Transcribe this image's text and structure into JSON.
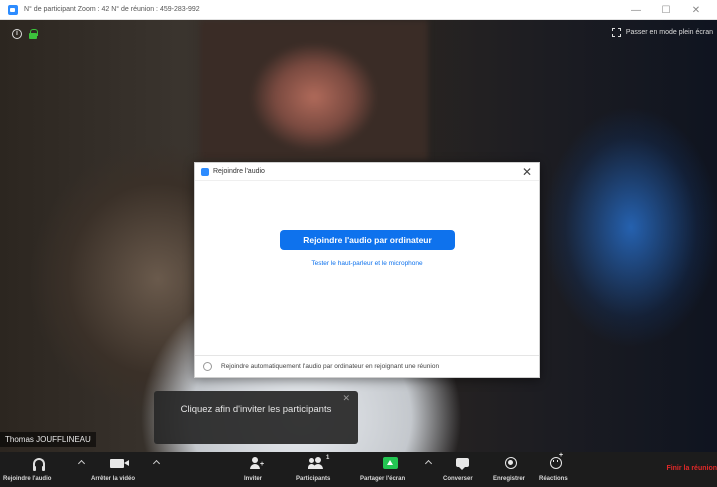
{
  "window": {
    "title": "N° de participant Zoom : 42   N° de réunion : 459-283-992",
    "minimize": "—",
    "maximize": "☐",
    "close": "✕"
  },
  "video": {
    "fullscreen_label": "Passer en mode plein écran",
    "participant_name": "Thomas JOUFFLINEAU"
  },
  "dialog": {
    "title": "Rejoindre l'audio",
    "close": "✕",
    "join_button": "Rejoindre l'audio par ordinateur",
    "test_link": "Tester le haut-parleur et le microphone",
    "auto_join_label": "Rejoindre automatiquement l'audio par ordinateur en rejoignant une réunion",
    "auto_join_checked": false
  },
  "tooltip": {
    "text": "Cliquez afin d'inviter les participants",
    "close": "✕"
  },
  "toolbar": {
    "join_audio": "Rejoindre l'audio",
    "stop_video": "Arrêter la vidéo",
    "invite": "Inviter",
    "participants": "Participants",
    "participants_count": "1",
    "share_screen": "Partager l'écran",
    "chat": "Converser",
    "record": "Enregistrer",
    "reactions": "Réactions",
    "end_meeting": "Finir la réunion"
  },
  "colors": {
    "accent": "#0e72ed",
    "share_green": "#23c552",
    "end_red": "#e02828",
    "secure_green": "#3cc13c"
  }
}
